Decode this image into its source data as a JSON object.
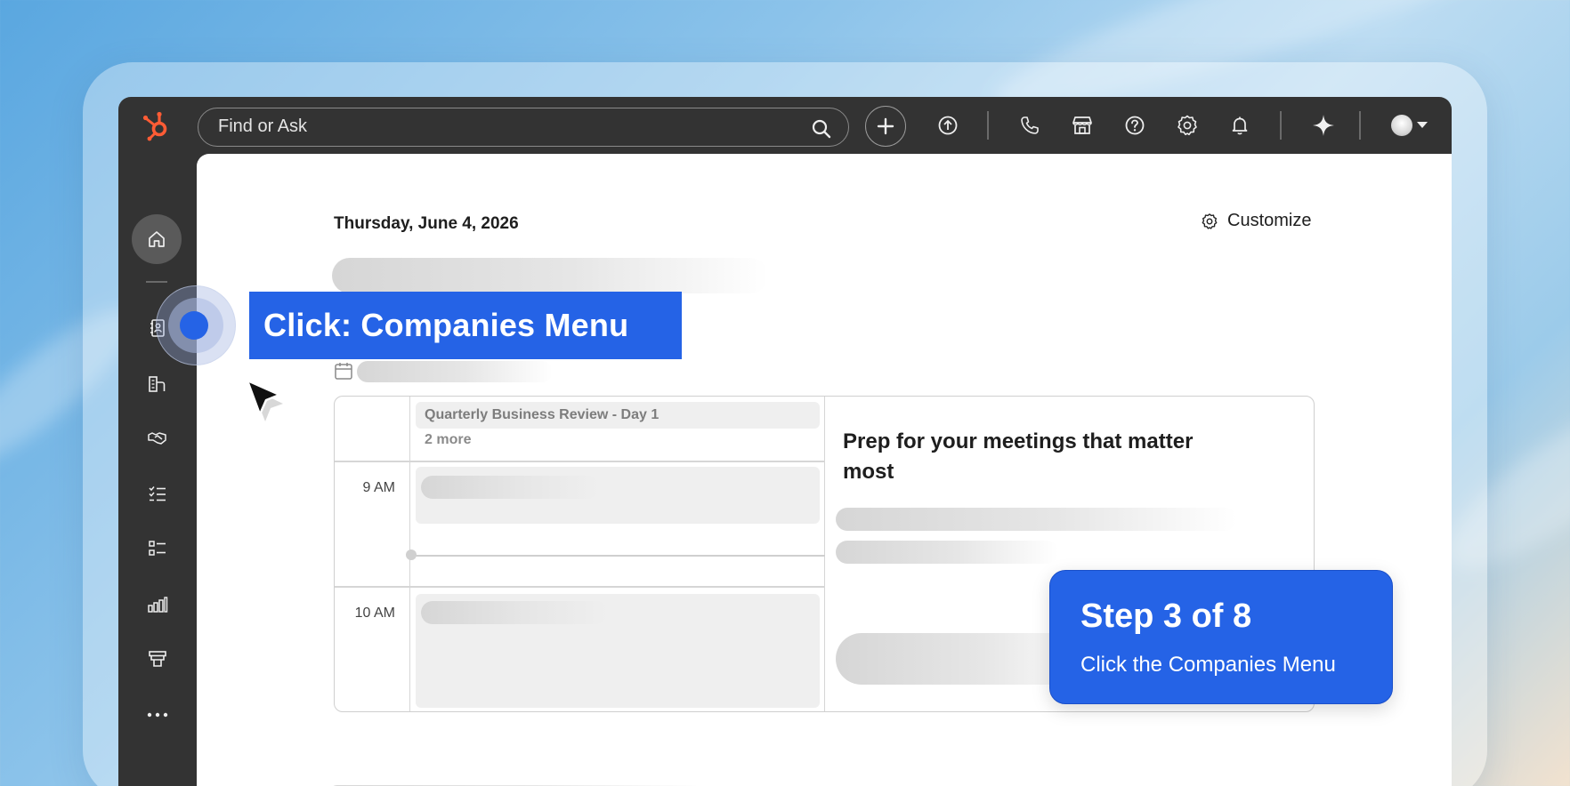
{
  "topbar": {
    "search_placeholder": "Find or Ask",
    "icons": [
      "hubspot-logo",
      "search-icon",
      "add-icon",
      "upload-icon",
      "phone-icon",
      "marketplace-icon",
      "help-icon",
      "settings-icon",
      "notifications-icon",
      "sparkle-icon",
      "avatar"
    ]
  },
  "sidebar": {
    "items": [
      "home-icon",
      "contacts-icon",
      "companies-icon",
      "deals-icon",
      "tasks-icon",
      "lists-icon",
      "reports-icon",
      "marketing-icon",
      "more-icon"
    ]
  },
  "main": {
    "date": "Thursday, June 4, 2026",
    "customize_label": "Customize",
    "calendar": {
      "event_title": "Quarterly Business Review - Day 1",
      "more_label": "2 more",
      "times": [
        "9 AM",
        "10 AM"
      ]
    },
    "prep_title": "Prep for your meetings that matter most"
  },
  "overlay": {
    "callout_label": "Click: Companies Menu",
    "step_title": "Step 3 of 8",
    "step_desc": "Click the Companies Menu"
  },
  "colors": {
    "accent": "#2563e6",
    "topbar": "#333333",
    "logo": "#ff5c35"
  }
}
